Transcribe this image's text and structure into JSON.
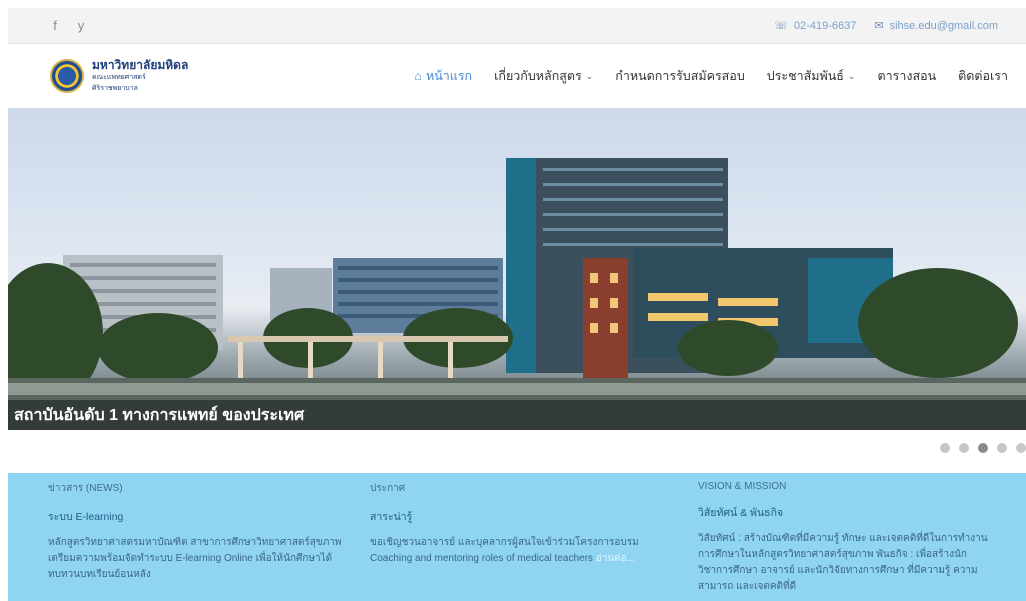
{
  "topbar": {
    "social": [
      {
        "icon": "facebook-icon",
        "glyph": "f"
      },
      {
        "icon": "twitter-icon",
        "glyph": "y"
      }
    ],
    "phone": "02-419-6637",
    "email": "sihse.edu@gmail.com"
  },
  "logo": {
    "line1": "มหาวิทยาลัยมหิดล",
    "line2": "คณะแพทยศาสตร์",
    "line3": "ศิริราชพยาบาล"
  },
  "nav": {
    "items": [
      {
        "label": "หน้าแรก",
        "active": true,
        "has_dropdown": false
      },
      {
        "label": "เกี่ยวกับหลักสูตร",
        "active": false,
        "has_dropdown": true
      },
      {
        "label": "กำหนดการรับสมัครสอบ",
        "active": false,
        "has_dropdown": false
      },
      {
        "label": "ประชาสัมพันธ์",
        "active": false,
        "has_dropdown": true
      },
      {
        "label": "ตารางสอน",
        "active": false,
        "has_dropdown": false
      },
      {
        "label": "ติดต่อเรา",
        "active": false,
        "has_dropdown": false
      }
    ]
  },
  "hero": {
    "caption": "สถาบันอันดับ 1 ทางการแพทย์ ของประเทศ",
    "slide_count": 5,
    "active_slide": 3
  },
  "columns": [
    {
      "heading": "ข่าวสาร (NEWS)",
      "subtitle": "ระบบ E-learning",
      "body": "หลักสูตรวิทยาศาสตรมหาบัณฑิต สาขาการศึกษาวิทยาศาสตร์สุขภาพ เตรียมความพร้อมจัดทำระบบ E-learning Online เพื่อให้นักศึกษาได้ทบทวนบทเรียนย้อนหลัง",
      "more": ""
    },
    {
      "heading": "ประกาศ",
      "subtitle": "สาระน่ารู้",
      "body": "ขอเชิญชวนอาจารย์ และบุคลากรผู้สนใจเข้าร่วมโครงการอบรม Coaching and mentoring roles of medical teachers",
      "more": "อ่านต่อ..."
    },
    {
      "heading": "VISION & MISSION",
      "subtitle": "วิสัยทัศน์ & พันธกิจ",
      "body": "วิสัยทัศน์ : สร้างบัณฑิตที่มีความรู้ ทักษะ และเจตคติที่ดีในการทำงานการศึกษาในหลักสูตรวิทยาศาสตร์สุขภาพ พันธกิจ : เพื่อสร้างนักวิชาการศึกษา อาจารย์ และนักวิจัยทางการศึกษา ที่มีความรู้ ความสามารถ และเจตคติที่ดี",
      "more": ""
    }
  ]
}
